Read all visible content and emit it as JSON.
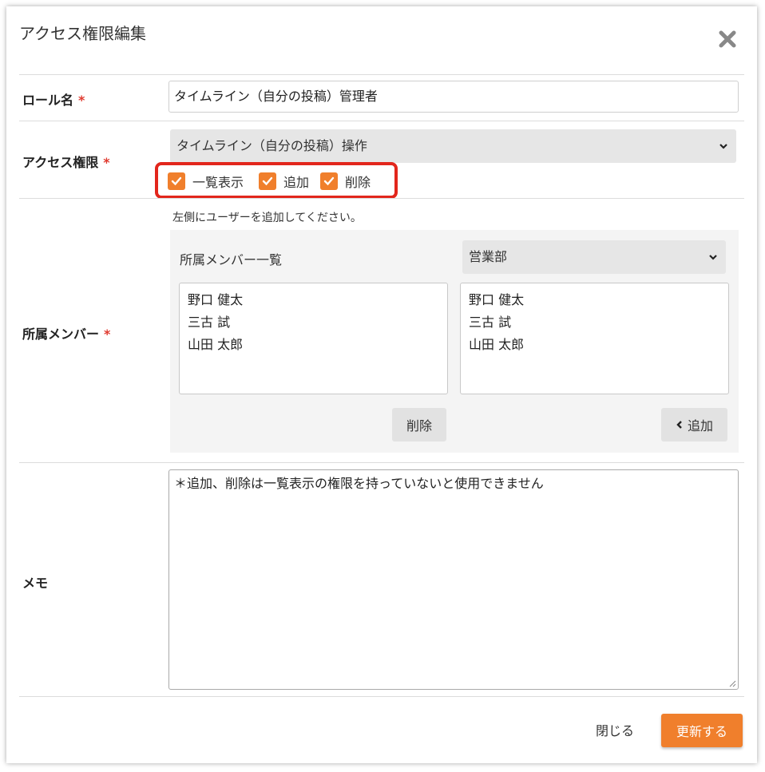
{
  "dialog": {
    "title": "アクセス権限編集"
  },
  "role": {
    "label": "ロール名",
    "required": "*",
    "value": "タイムライン（自分の投稿）管理者"
  },
  "access": {
    "label": "アクセス権限",
    "required": "*",
    "selected": "タイムライン（自分の投稿）操作",
    "checkboxes": [
      {
        "label": "一覧表示",
        "checked": true
      },
      {
        "label": "追加",
        "checked": true
      },
      {
        "label": "削除",
        "checked": true
      }
    ]
  },
  "members": {
    "label": "所属メンバー",
    "required": "*",
    "instruction": "左側にユーザーを追加してください。",
    "list_title": "所属メンバー一覧",
    "department": "営業部",
    "assigned": [
      "野口 健太",
      "三古 試",
      "山田 太郎"
    ],
    "available": [
      "野口 健太",
      "三古 試",
      "山田 太郎"
    ],
    "remove_label": "削除",
    "add_label": "追加"
  },
  "memo": {
    "label": "メモ",
    "value": "＊追加、削除は一覧表示の権限を持っていないと使用できません"
  },
  "footer": {
    "close_label": "閉じる",
    "update_label": "更新する"
  },
  "colors": {
    "accent": "#f07f2c",
    "highlight": "#e2261c",
    "required": "#e03a2f"
  }
}
